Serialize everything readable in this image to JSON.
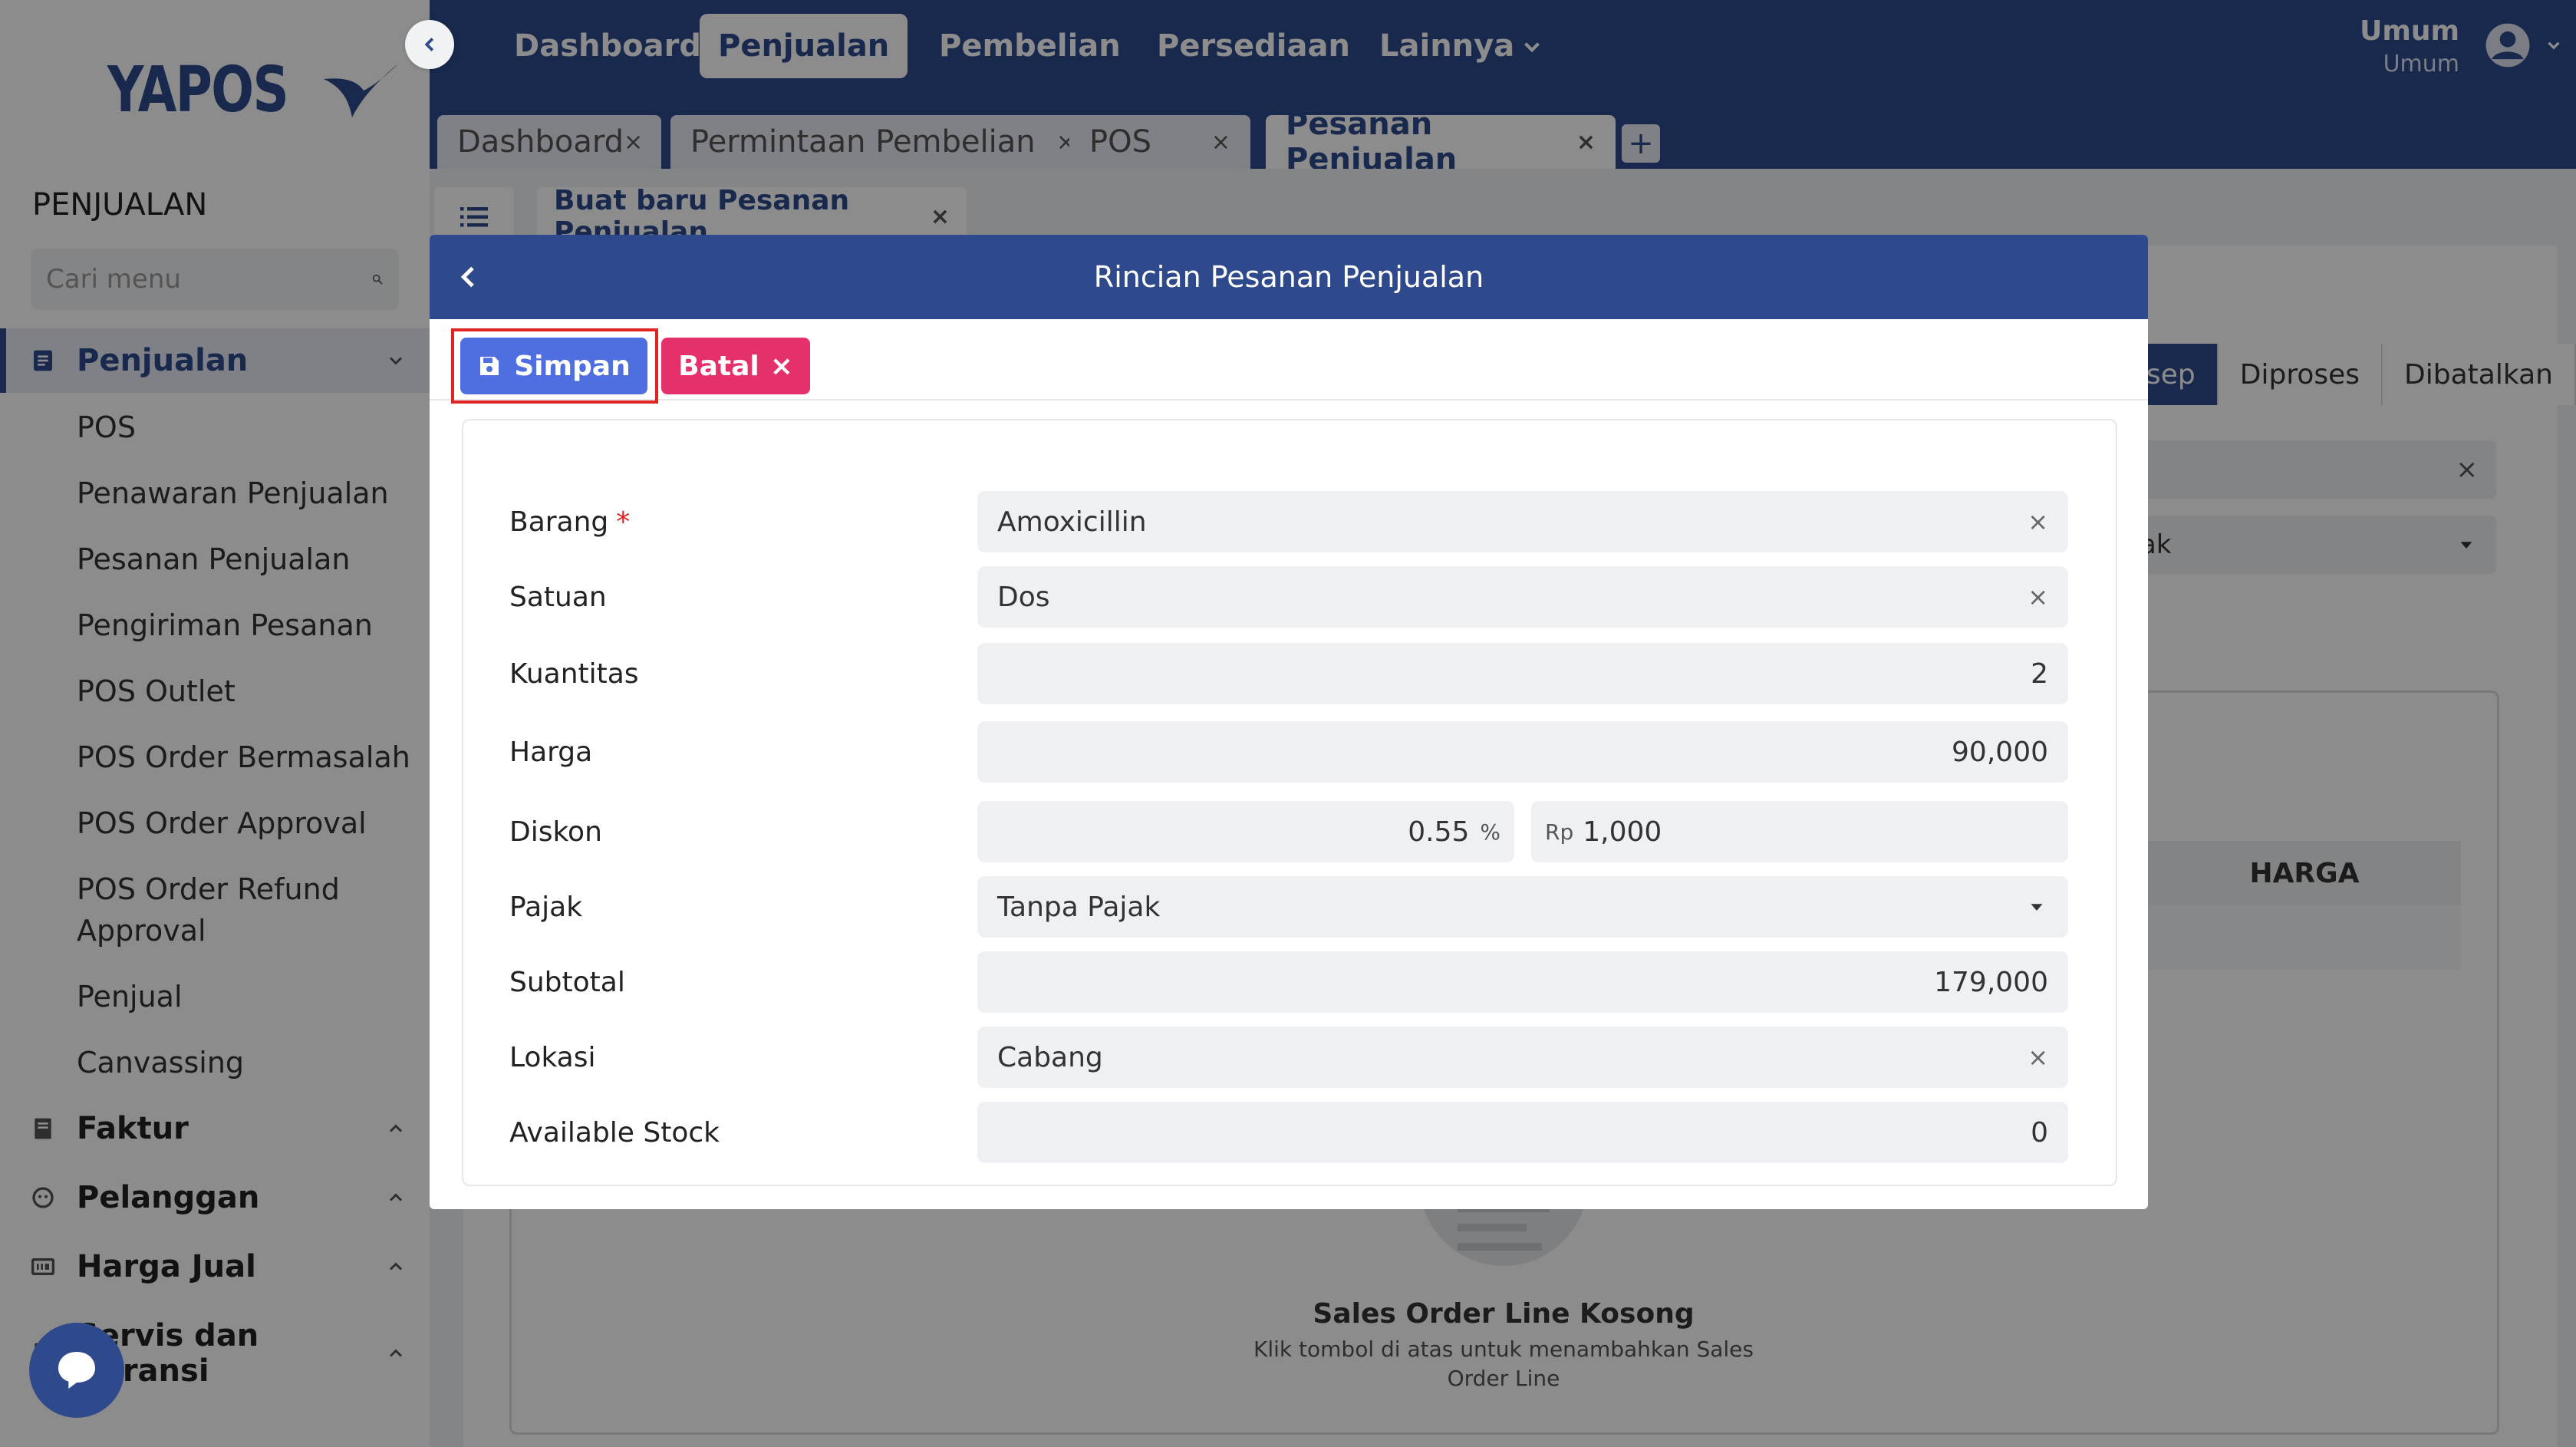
{
  "logo": {
    "text": "YAPOS"
  },
  "sidebar": {
    "section_title": "PENJUALAN",
    "search_placeholder": "Cari menu",
    "active_group": "Penjualan",
    "sub_items": [
      "POS",
      "Penawaran Penjualan",
      "Pesanan Penjualan",
      "Pengiriman Pesanan",
      "POS Outlet",
      "POS Order Bermasalah",
      "POS Order Approval",
      "POS Order Refund Approval",
      "Penjual",
      "Canvassing"
    ],
    "groups": [
      "Faktur",
      "Pelanggan",
      "Harga Jual",
      "Servis dan Garansi"
    ]
  },
  "topnav": {
    "items": [
      "Dashboard",
      "Penjualan",
      "Pembelian",
      "Persediaan",
      "Lainnya"
    ],
    "active": "Penjualan",
    "user_name": "Umum",
    "user_role": "Umum"
  },
  "tabs": [
    {
      "label": "Dashboard",
      "close": "×"
    },
    {
      "label": "Permintaan Pembelian",
      "close": "×"
    },
    {
      "label": "POS",
      "close": "×"
    },
    {
      "label": "Pesanan Penjualan",
      "close": "×"
    }
  ],
  "tab_add": "+",
  "subtab": {
    "label": "Buat baru Pesanan Penjualan",
    "close": "×"
  },
  "background": {
    "steps": [
      "sep",
      "Diproses",
      "Dibatalkan"
    ],
    "field_text": "ak",
    "close_glyph": "×",
    "table_header": "HARGA",
    "empty_title": "Sales Order Line Kosong",
    "empty_subtitle": "Klik tombol di atas untuk menambahkan Sales Order Line"
  },
  "modal": {
    "title": "Rincian Pesanan Penjualan",
    "save_label": "Simpan",
    "cancel_label": "Batal",
    "cancel_glyph": "×",
    "required_mark": "*",
    "clear_glyph": "×",
    "fields": {
      "barang": {
        "label": "Barang",
        "value": "Amoxicillin"
      },
      "satuan": {
        "label": "Satuan",
        "value": "Dos"
      },
      "kuantitas": {
        "label": "Kuantitas",
        "value": "2"
      },
      "harga": {
        "label": "Harga",
        "value": "90,000"
      },
      "diskon": {
        "label": "Diskon",
        "percent_value": "0.55",
        "percent_unit": "%",
        "amount_prefix": "Rp",
        "amount_value": "1,000"
      },
      "pajak": {
        "label": "Pajak",
        "value": "Tanpa Pajak"
      },
      "subtotal": {
        "label": "Subtotal",
        "value": "179,000"
      },
      "lokasi": {
        "label": "Lokasi",
        "value": "Cabang"
      },
      "available_stock": {
        "label": "Available Stock",
        "value": "0"
      }
    }
  },
  "colors": {
    "primary": "#2f4a8c",
    "save": "#4f6fe0",
    "cancel": "#e6306a",
    "highlight": "#e02424"
  }
}
